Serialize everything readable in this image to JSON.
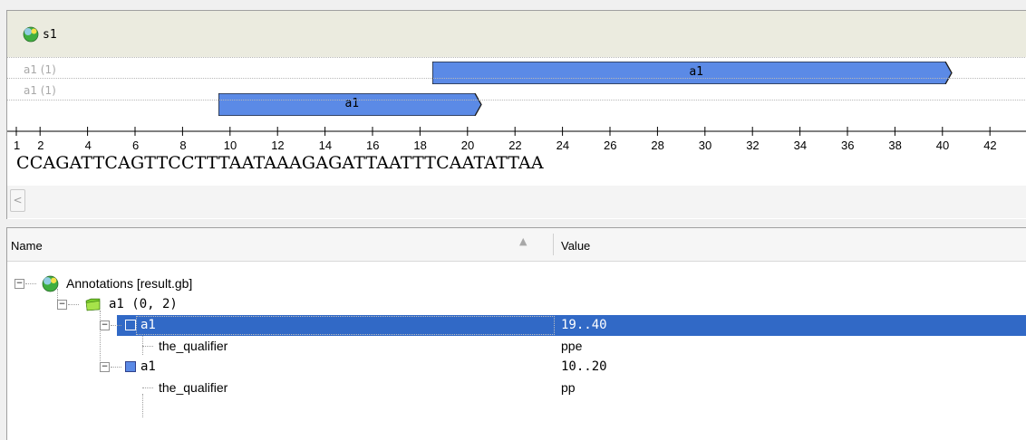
{
  "sequence_view": {
    "title": "s1",
    "tracks": [
      {
        "name": "a1 (1)",
        "annotation": {
          "label": "a1",
          "start": 19,
          "end": 40
        }
      },
      {
        "name": "a1 (1)",
        "annotation": {
          "label": "a1",
          "start": 10,
          "end": 20
        }
      }
    ],
    "ruler_labels": [
      "1",
      "2",
      "4",
      "6",
      "8",
      "10",
      "12",
      "14",
      "16",
      "18",
      "20",
      "22",
      "24",
      "26",
      "28",
      "30",
      "32",
      "34",
      "36",
      "38",
      "40",
      "42"
    ],
    "bases": "CCAGATTCAGTTCCTTTAATAAAGAGATTAATTTCAATATTAA",
    "scroll_left_arrow": "<"
  },
  "tree": {
    "columns": {
      "name": "Name",
      "value": "Value"
    },
    "sort_arrow": "▲",
    "root": {
      "label": "Annotations [result.gb]"
    },
    "group": {
      "label": "a1  (0, 2)"
    },
    "items": [
      {
        "label": "a1",
        "value": "19..40",
        "qualifier": {
          "name": "the_qualifier",
          "value": "ppe"
        }
      },
      {
        "label": "a1",
        "value": "10..20",
        "qualifier": {
          "name": "the_qualifier",
          "value": "pp"
        }
      }
    ],
    "expander_symbol": "−",
    "colors": {
      "selection": "#3169c6",
      "annotation_fill": "#5b8ae6"
    }
  }
}
